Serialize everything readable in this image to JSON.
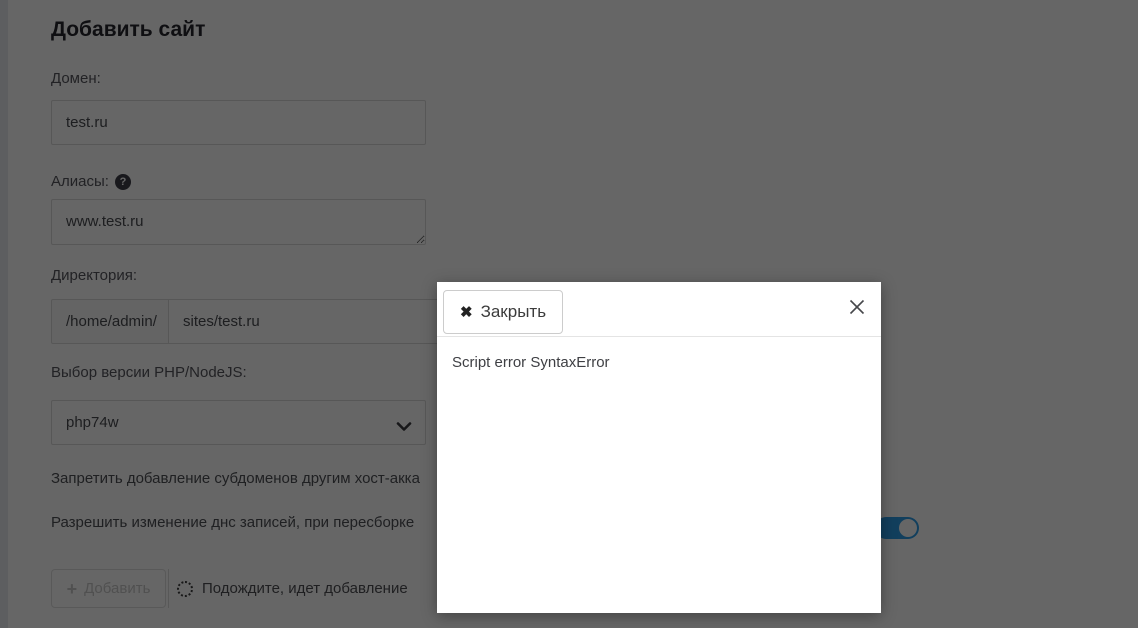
{
  "window": {
    "title": "Добавить сайт"
  },
  "form": {
    "domain": {
      "label": "Домен:",
      "value": "test.ru"
    },
    "aliases": {
      "label": "Алиасы:",
      "value": "www.test.ru",
      "help_icon": {
        "name": "question-circle-icon",
        "glyph": "?"
      }
    },
    "directory": {
      "label": "Директория:",
      "prefix": "/home/admin/",
      "value": "sites/test.ru"
    },
    "php_version": {
      "label": "Выбор версии PHP/NodeJS:",
      "selected": "php74w",
      "icon": "chevron-down-icon"
    },
    "option_subdomains": {
      "label": "Запретить добавление субдоменов другим хост-акка"
    },
    "option_dns": {
      "label": "Разрешить изменение днс записей, при пересборке",
      "toggle_state": "on"
    },
    "submit_button": {
      "icon": "plus-icon",
      "glyph": "+",
      "label": "Добавить",
      "disabled": true
    },
    "status": {
      "icon": "spinner-icon",
      "text": "Подождите, идет добавление"
    }
  },
  "modal": {
    "close_button": {
      "icon": "heavy-x-icon",
      "glyph": "✖",
      "label": "Закрыть"
    },
    "close_icon": "x-icon",
    "message": "Script error SyntaxError"
  },
  "colors": {
    "toggle_on": "#2f9ee8",
    "overlay": "rgba(0,0,0,0.6)",
    "modal_background": "#ffffff"
  }
}
